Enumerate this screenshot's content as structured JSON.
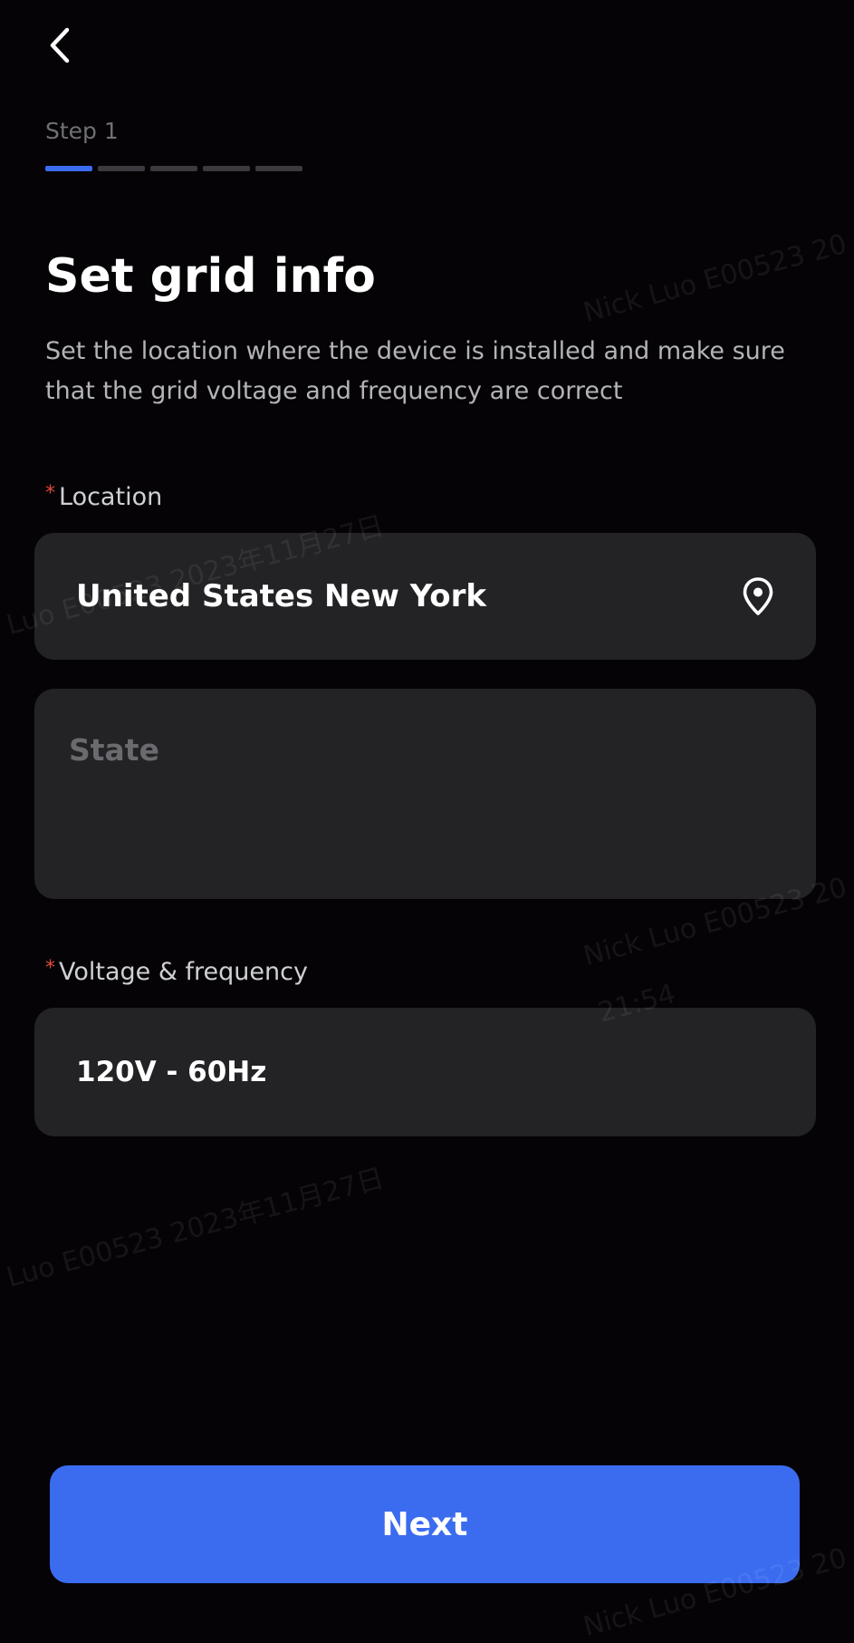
{
  "header": {
    "back_icon": "chevron-left-icon",
    "step_label": "Step 1",
    "progress": {
      "current_step": 1,
      "total_steps": 5
    }
  },
  "page": {
    "title": "Set grid info",
    "subtitle": "Set the location where the device is installed and make sure that the grid voltage and frequency are correct"
  },
  "form": {
    "location": {
      "label": "Location",
      "required_mark": "*",
      "value": "United States New York",
      "icon": "location-pin-icon"
    },
    "state": {
      "placeholder": "State"
    },
    "voltage": {
      "label": "Voltage & frequency",
      "required_mark": "*",
      "value": "120V - 60Hz"
    }
  },
  "actions": {
    "next_label": "Next"
  },
  "watermarks": [
    "Nick Luo E00523 20",
    "Luo E00523 2023年11月27日",
    "Nick Luo E00523 20",
    "21:54",
    "Luo E00523 2023年11月27日",
    "Nick Luo E00523 20"
  ],
  "colors": {
    "background": "#050306",
    "field_background": "#232225",
    "accent": "#3b6cf0",
    "required": "#e5483b",
    "progress_inactive": "#3a3a3f"
  }
}
